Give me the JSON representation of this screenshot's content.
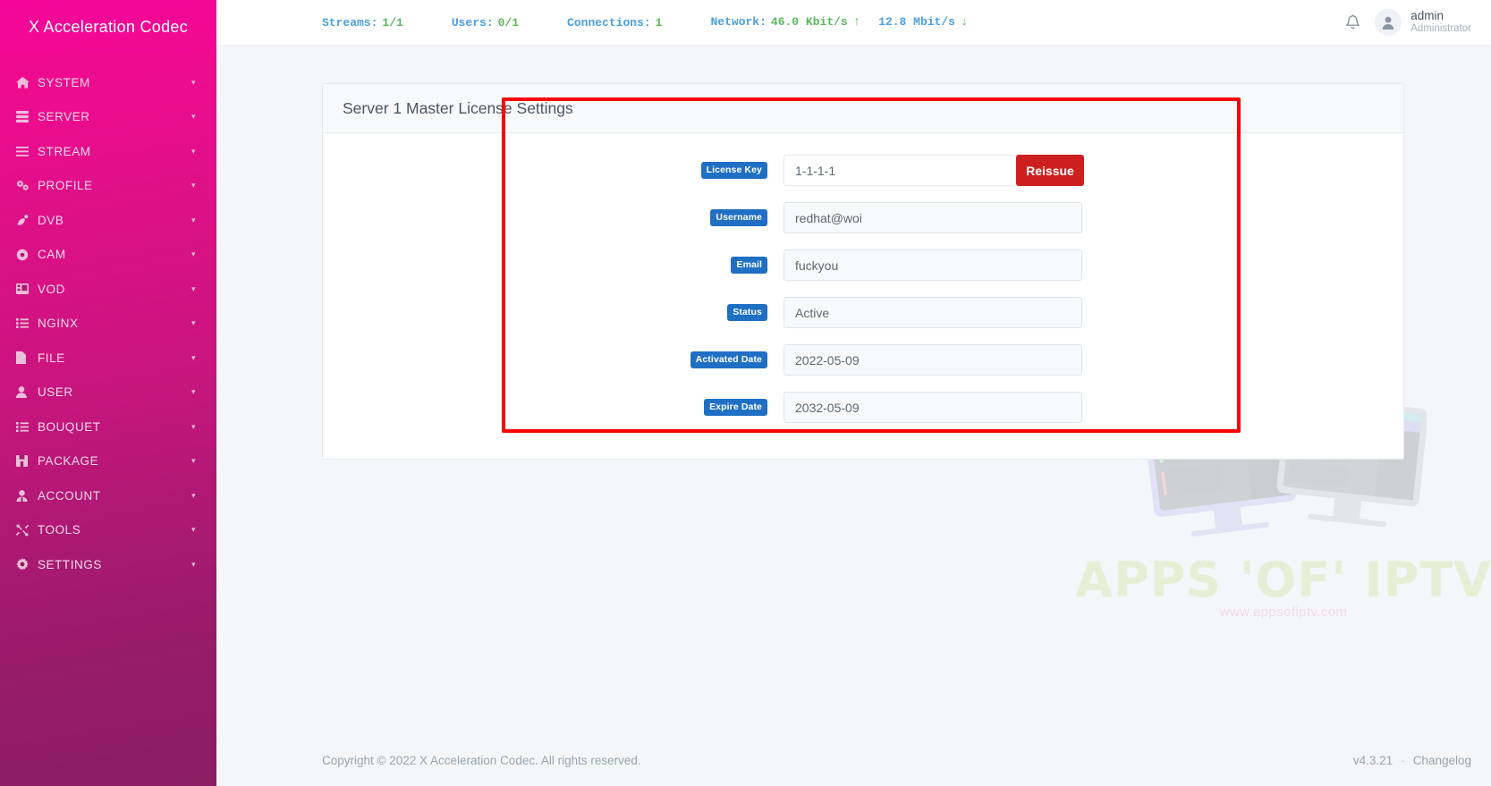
{
  "brand": {
    "title": "X Acceleration Codec"
  },
  "sidebar": {
    "items": [
      {
        "label": "SYSTEM",
        "icon": "home-icon"
      },
      {
        "label": "SERVER",
        "icon": "server-icon"
      },
      {
        "label": "STREAM",
        "icon": "stream-icon"
      },
      {
        "label": "PROFILE",
        "icon": "gears-icon"
      },
      {
        "label": "DVB",
        "icon": "satellite-dish-icon"
      },
      {
        "label": "CAM",
        "icon": "cam-icon"
      },
      {
        "label": "VOD",
        "icon": "film-icon"
      },
      {
        "label": "NGINX",
        "icon": "list-icon"
      },
      {
        "label": "FILE",
        "icon": "file-icon"
      },
      {
        "label": "USER",
        "icon": "user-icon"
      },
      {
        "label": "BOUQUET",
        "icon": "list-icon"
      },
      {
        "label": "PACKAGE",
        "icon": "package-icon"
      },
      {
        "label": "ACCOUNT",
        "icon": "account-icon"
      },
      {
        "label": "TOOLS",
        "icon": "tools-icon"
      },
      {
        "label": "SETTINGS",
        "icon": "gear-icon"
      }
    ],
    "caret": "▾"
  },
  "header": {
    "stats": [
      {
        "label": "Streams:",
        "value": "1/1"
      },
      {
        "label": "Users:",
        "value": "0/1"
      },
      {
        "label": "Connections:",
        "value": "1"
      }
    ],
    "network": {
      "label": "Network:",
      "upload": "46.0 Kbit/s",
      "upload_arrow": "↑",
      "download": "12.8 Mbit/s",
      "download_arrow": "↓"
    },
    "notification_icon": "bell-icon",
    "user": {
      "name": "admin",
      "role": "Administrator",
      "avatar_icon": "user-avatar-icon"
    }
  },
  "card": {
    "title": "Server 1 Master License Settings",
    "fields": [
      {
        "label": "License Key",
        "value": "1-1-1-1"
      },
      {
        "label": "Username",
        "value": "redhat@woi"
      },
      {
        "label": "Email",
        "value": "fuckyou"
      },
      {
        "label": "Status",
        "value": "Active"
      },
      {
        "label": "Activated Date",
        "value": "2022-05-09"
      },
      {
        "label": "Expire Date",
        "value": "2032-05-09"
      }
    ],
    "reissue_label": "Reissue"
  },
  "watermark": {
    "title": "APPS 'OF' IPTV",
    "url": "www.appsofiptv.com"
  },
  "footer": {
    "copyright": "Copyright © 2022 X Acceleration Codec. All rights reserved.",
    "version": "v4.3.21",
    "separator": "·",
    "changelog": "Changelog"
  },
  "colors": {
    "sidebar_top": "#f2078f",
    "sidebar_bottom": "#8a1d63",
    "badge_blue": "#1f6fc4",
    "reissue_red": "#cd1f1f",
    "annotation_red": "#fe0000",
    "stat_label": "#4a9fe0",
    "stat_value": "#5cb85c",
    "watermark_green": "#b9d95e"
  }
}
